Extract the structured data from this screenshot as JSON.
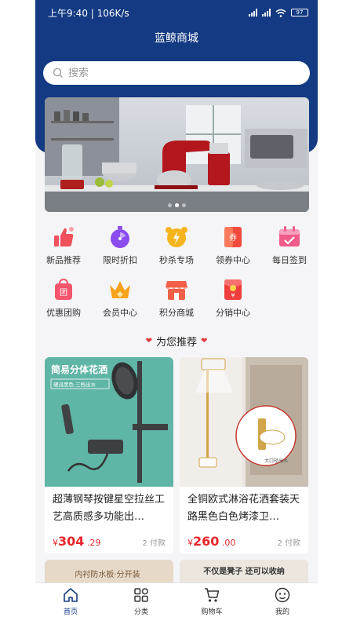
{
  "status_bar": {
    "time_speed": "上午9:40 | 106K/s",
    "battery": "97"
  },
  "header": {
    "title": "蓝鲸商城"
  },
  "search": {
    "placeholder": "搜索"
  },
  "banner": {
    "slide_count": 3,
    "active_slide": 1
  },
  "categories": [
    {
      "label": "新品推荐",
      "icon": "thumbs-up-icon",
      "color": "#f0515d"
    },
    {
      "label": "限时折扣",
      "icon": "stopwatch-icon",
      "color": "#8b4cf0"
    },
    {
      "label": "秒杀专场",
      "icon": "alarm-clock-icon",
      "color": "#f5b41c"
    },
    {
      "label": "领券中心",
      "icon": "coupon-icon",
      "color": "#f24a3c"
    },
    {
      "label": "每日签到",
      "icon": "calendar-check-icon",
      "color": "#f05b8a"
    },
    {
      "label": "优惠团购",
      "icon": "group-buy-bag-icon",
      "color": "#f5556d"
    },
    {
      "label": "会员中心",
      "icon": "crown-icon",
      "color": "#f7a21b"
    },
    {
      "label": "积分商城",
      "icon": "store-icon",
      "color": "#f26049"
    },
    {
      "label": "分销中心",
      "icon": "red-envelope-icon",
      "color": "#f03c3c"
    }
  ],
  "recommend": {
    "title": "为您推荐"
  },
  "products": [
    {
      "image_text": "简易分体花洒",
      "image_subtext": "硬派黑色·三档出水",
      "name": "超薄钢琴按键星空拉丝工艺高质感多功能出…",
      "price_symbol": "¥",
      "price_int": "304",
      "price_dec": ".29",
      "sold": "2 付款"
    },
    {
      "image_subtext": "大口径出水",
      "name": "全铜欧式淋浴花洒套装天路黑色白色烤漆卫…",
      "price_symbol": "¥",
      "price_int": "260",
      "price_dec": ".00",
      "sold": "2 付款"
    },
    {
      "image_text": "内衬防水板·分开装"
    },
    {
      "image_text": "不仅是凳子 还可以收纳"
    }
  ],
  "tabbar": [
    {
      "label": "首页",
      "icon": "home-icon",
      "active": true
    },
    {
      "label": "分类",
      "icon": "grid-icon",
      "active": false
    },
    {
      "label": "购物车",
      "icon": "cart-icon",
      "active": false
    },
    {
      "label": "我的",
      "icon": "profile-icon",
      "active": false
    }
  ],
  "colors": {
    "brand": "#133a83",
    "price": "#e8262b"
  }
}
